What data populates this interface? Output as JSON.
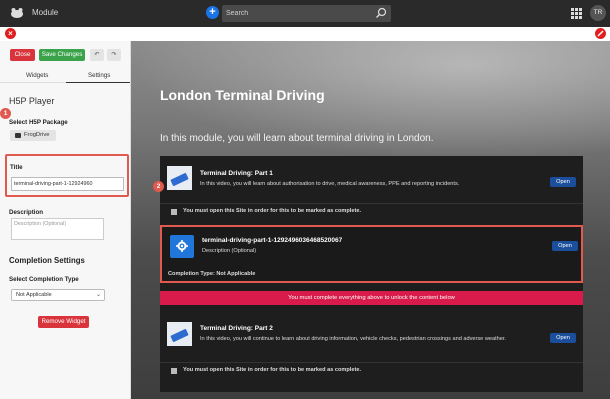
{
  "topbar": {
    "app_title": "Module",
    "search_placeholder": "Search",
    "avatar_initials": "TR",
    "accent": "#1a73e8"
  },
  "toolbar": {
    "close_label": "Close",
    "save_label": "Save Changes",
    "undo_icon": "undo-icon",
    "redo_icon": "redo-icon"
  },
  "sidebar": {
    "tabs": [
      {
        "label": "Widgets"
      },
      {
        "label": "Settings",
        "active": true
      }
    ],
    "panel_title": "H5P Player",
    "package_label": "Select H5P Package",
    "frogdrive_label": "FrogDrive",
    "title_label": "Title",
    "title_value": "terminal-driving-part-1-12924960",
    "description_label": "Description",
    "description_placeholder": "Description (Optional)",
    "completion_title": "Completion Settings",
    "completion_type_label": "Select Completion Type",
    "completion_type_value": "Not Applicable",
    "remove_label": "Remove Widget"
  },
  "annotations": {
    "badge_1": "1",
    "badge_2": "2",
    "color": "#e05a4f"
  },
  "main": {
    "hero_title": "London Terminal Driving",
    "hero_subtitle": "In this module, you will learn about terminal driving in London.",
    "cards": [
      {
        "title": "Terminal Driving: Part 1",
        "description": "In this video, you will learn about authorisation to drive, medical awareness, PPE and reporting incidents.",
        "open_label": "Open",
        "check_text": "You must open this Site in order for this to be marked as complete."
      },
      {
        "title": "terminal-driving-part-1-1292496036468520067",
        "description": "Description (Optional)",
        "open_label": "Open",
        "completion_text": "Completion Type: Not Applicable"
      },
      {
        "title": "Terminal Driving: Part 2",
        "description": "In this video, you will continue to learn about driving information, vehicle checks, pedestrian crossings and adverse weather.",
        "open_label": "Open",
        "check_text": "You must open this Site in order for this to be marked as complete."
      }
    ],
    "warning_text": "You must complete everything above to unlock the content below",
    "warning_color": "#d81b4a"
  }
}
